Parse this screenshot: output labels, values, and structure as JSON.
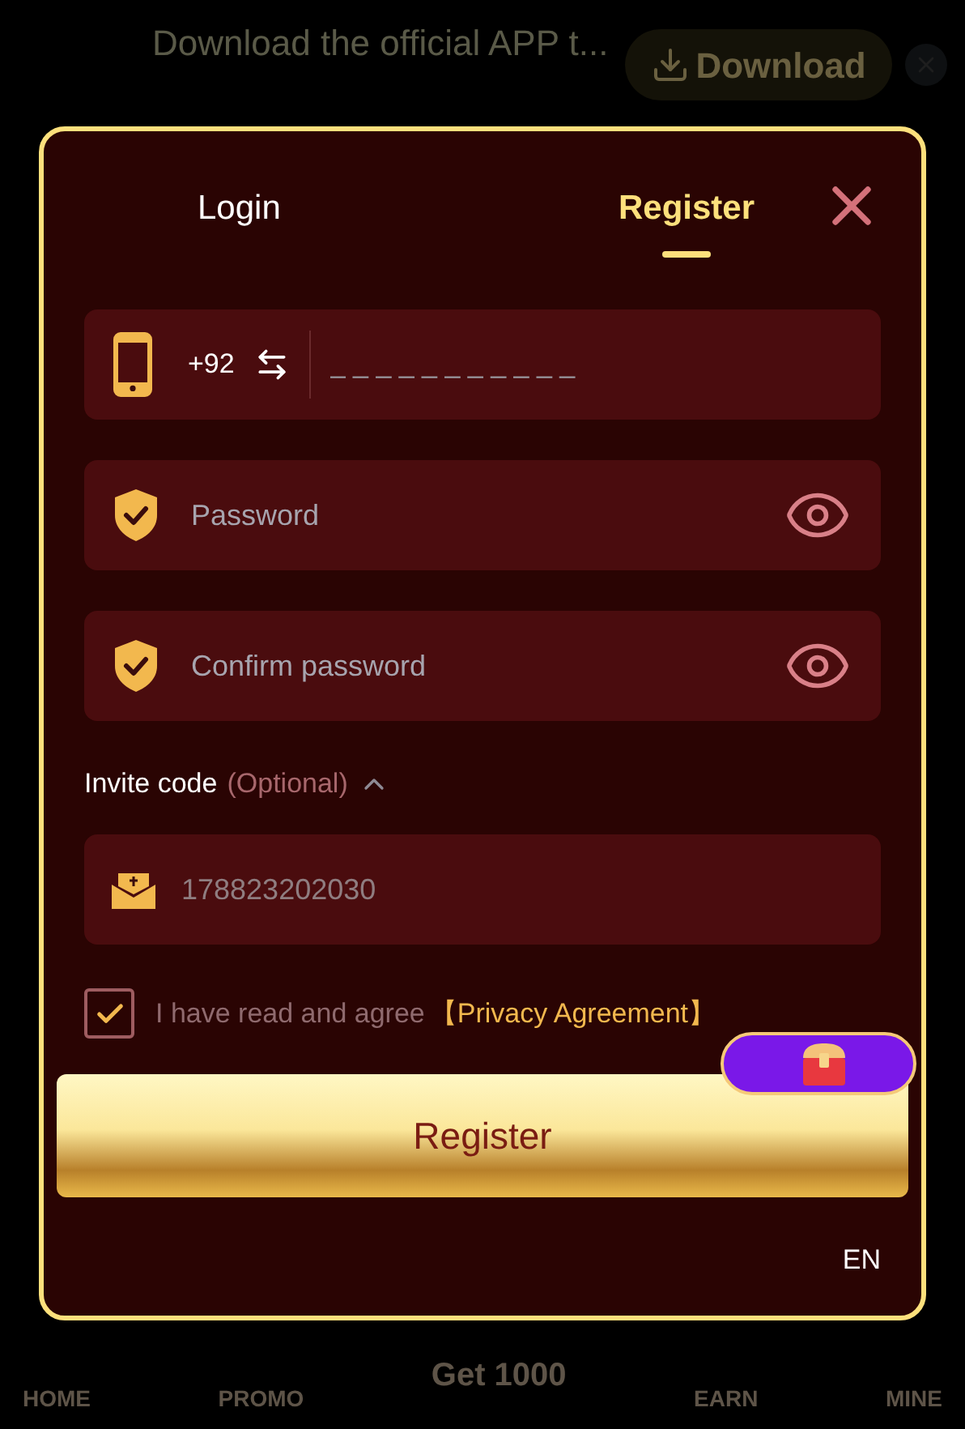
{
  "banner": {
    "text": "Download the official APP t...",
    "download_button": "Download"
  },
  "tabs": [
    {
      "label": "Login",
      "selected": false
    },
    {
      "label": "Register",
      "selected": true
    }
  ],
  "phone_field": {
    "country_code": "+92",
    "placeholder": "_ _ _ _ _ _ _ _ _ _ _"
  },
  "password_fields": [
    {
      "placeholder": "Password"
    },
    {
      "placeholder": "Confirm password"
    }
  ],
  "invite": {
    "label": "Invite code",
    "optional": "(Optional)",
    "expanded": true,
    "placeholder": "178823202030"
  },
  "agreement": {
    "checked": true,
    "text": "I have read and agree",
    "link": "【Privacy Agreement】"
  },
  "register_button": "Register",
  "language": "EN",
  "bottom_nav": [
    {
      "label": "HOME"
    },
    {
      "label": "PROMO"
    },
    {
      "label": "Get 1000"
    },
    {
      "label": "EARN"
    },
    {
      "label": "MINE"
    }
  ]
}
